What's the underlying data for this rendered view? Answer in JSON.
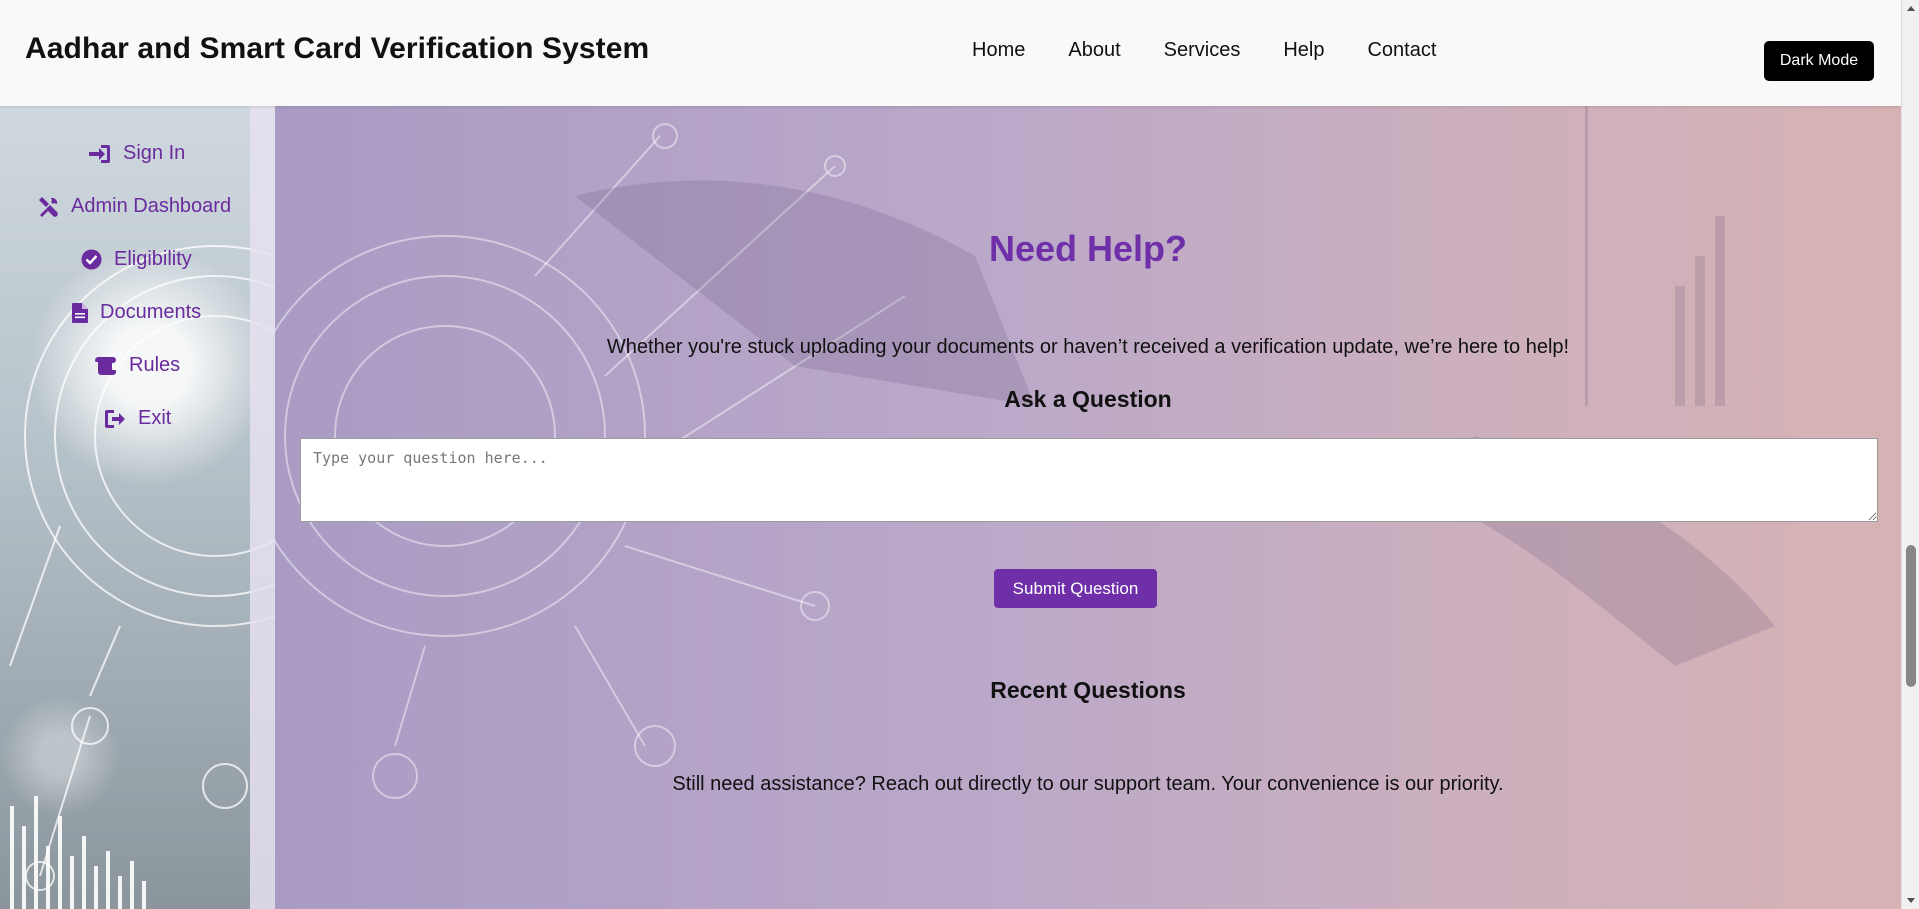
{
  "header": {
    "title": "Aadhar and Smart Card Verification System",
    "nav": [
      {
        "label": "Home"
      },
      {
        "label": "About"
      },
      {
        "label": "Services"
      },
      {
        "label": "Help"
      },
      {
        "label": "Contact"
      }
    ],
    "dark_mode_label": "Dark Mode"
  },
  "sidebar": {
    "items": [
      {
        "label": "Sign In",
        "icon": "sign-in-icon"
      },
      {
        "label": "Admin Dashboard",
        "icon": "tools-icon"
      },
      {
        "label": "Eligibility",
        "icon": "check-circle-icon"
      },
      {
        "label": "Documents",
        "icon": "file-icon"
      },
      {
        "label": "Rules",
        "icon": "scroll-icon"
      },
      {
        "label": "Exit",
        "icon": "sign-out-icon"
      }
    ]
  },
  "main": {
    "title": "Need Help?",
    "intro": "Whether you're stuck uploading your documents or haven’t received a verification update, we’re here to help!",
    "ask_title": "Ask a Question",
    "question_placeholder": "Type your question here...",
    "question_value": "",
    "submit_label": "Submit Question",
    "recent_title": "Recent Questions",
    "assist_text": "Still need assistance? Reach out directly to our support team. Your convenience is our priority."
  },
  "colors": {
    "accent": "#6f2fa8",
    "sidebar_text": "#6a2b9e",
    "header_bg": "#f9f9f9",
    "dark_button": "#000000"
  }
}
